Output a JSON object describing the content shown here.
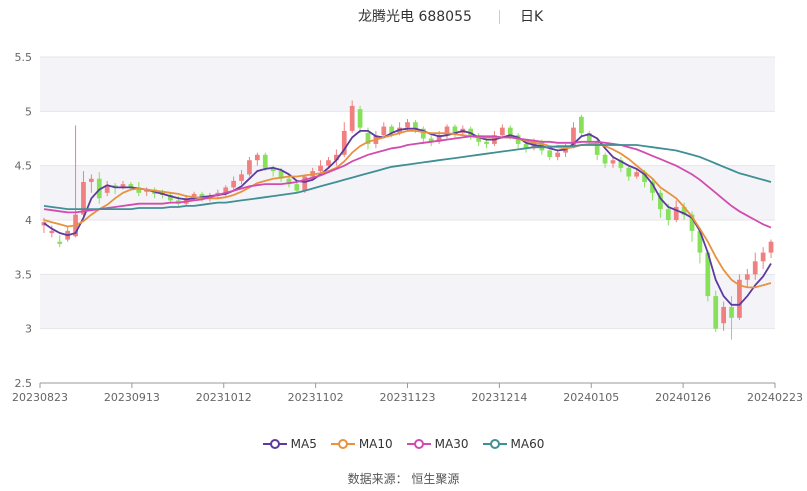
{
  "header": {
    "title": "龙腾光电 688055",
    "period": "日K"
  },
  "source_text": "数据来源： 恒生聚源",
  "colors": {
    "up": "#f08080",
    "down": "#86e05a",
    "ma5": "#5b3b9e",
    "ma10": "#e8913f",
    "ma30": "#d24bb0",
    "ma60": "#3f8f94",
    "grid_band": "#f4f4f8"
  },
  "chart_data": {
    "type": "candlestick",
    "x_ticks": [
      "20230823",
      "20230913",
      "20231012",
      "20231102",
      "20231123",
      "20231214",
      "20240105",
      "20240126",
      "20240223"
    ],
    "ylim": [
      2.5,
      5.5
    ],
    "y_ticks": [
      "5.5",
      "5",
      "4.5",
      "4",
      "3.5",
      "3",
      "2.5"
    ],
    "legend": [
      "MA5",
      "MA10",
      "MA30",
      "MA60"
    ],
    "legend_position": "bottom",
    "candles": [
      [
        3.95,
        3.98,
        3.88,
        4.02
      ],
      [
        3.88,
        3.9,
        3.84,
        3.95
      ],
      [
        3.8,
        3.78,
        3.75,
        3.86
      ],
      [
        3.82,
        3.9,
        3.8,
        3.94
      ],
      [
        3.85,
        4.05,
        3.84,
        4.87
      ],
      [
        4.05,
        4.35,
        4.02,
        4.45
      ],
      [
        4.35,
        4.38,
        4.25,
        4.42
      ],
      [
        4.38,
        4.2,
        4.15,
        4.44
      ],
      [
        4.25,
        4.32,
        4.22,
        4.36
      ],
      [
        4.32,
        4.3,
        4.24,
        4.34
      ],
      [
        4.3,
        4.33,
        4.28,
        4.36
      ],
      [
        4.33,
        4.3,
        4.27,
        4.35
      ],
      [
        4.3,
        4.25,
        4.22,
        4.35
      ],
      [
        4.26,
        4.28,
        4.22,
        4.3
      ],
      [
        4.28,
        4.24,
        4.2,
        4.3
      ],
      [
        4.25,
        4.23,
        4.2,
        4.28
      ],
      [
        4.23,
        4.18,
        4.15,
        4.25
      ],
      [
        4.18,
        4.15,
        4.13,
        4.22
      ],
      [
        4.15,
        4.2,
        4.13,
        4.23
      ],
      [
        4.2,
        4.24,
        4.18,
        4.26
      ],
      [
        4.24,
        4.2,
        4.17,
        4.26
      ],
      [
        4.2,
        4.22,
        4.17,
        4.25
      ],
      [
        4.22,
        4.25,
        4.2,
        4.28
      ],
      [
        4.25,
        4.3,
        4.22,
        4.32
      ],
      [
        4.3,
        4.36,
        4.28,
        4.4
      ],
      [
        4.36,
        4.42,
        4.33,
        4.46
      ],
      [
        4.42,
        4.55,
        4.4,
        4.58
      ],
      [
        4.55,
        4.6,
        4.5,
        4.62
      ],
      [
        4.6,
        4.48,
        4.45,
        4.62
      ],
      [
        4.48,
        4.45,
        4.4,
        4.5
      ],
      [
        4.45,
        4.38,
        4.35,
        4.48
      ],
      [
        4.38,
        4.33,
        4.3,
        4.42
      ],
      [
        4.33,
        4.27,
        4.25,
        4.36
      ],
      [
        4.27,
        4.4,
        4.25,
        4.42
      ],
      [
        4.4,
        4.45,
        4.38,
        4.48
      ],
      [
        4.45,
        4.5,
        4.42,
        4.55
      ],
      [
        4.5,
        4.55,
        4.47,
        4.58
      ],
      [
        4.55,
        4.6,
        4.5,
        4.65
      ],
      [
        4.6,
        4.82,
        4.58,
        4.9
      ],
      [
        4.82,
        5.05,
        4.8,
        5.1
      ],
      [
        5.02,
        4.85,
        4.8,
        5.05
      ],
      [
        4.8,
        4.7,
        4.65,
        4.85
      ],
      [
        4.7,
        4.78,
        4.66,
        4.82
      ],
      [
        4.78,
        4.86,
        4.75,
        4.9
      ],
      [
        4.86,
        4.8,
        4.76,
        4.88
      ],
      [
        4.8,
        4.85,
        4.78,
        4.9
      ],
      [
        4.85,
        4.9,
        4.82,
        4.93
      ],
      [
        4.9,
        4.84,
        4.8,
        4.92
      ],
      [
        4.84,
        4.75,
        4.7,
        4.86
      ],
      [
        4.75,
        4.72,
        4.68,
        4.78
      ],
      [
        4.72,
        4.78,
        4.7,
        4.82
      ],
      [
        4.78,
        4.86,
        4.75,
        4.88
      ],
      [
        4.86,
        4.8,
        4.76,
        4.88
      ],
      [
        4.8,
        4.84,
        4.78,
        4.87
      ],
      [
        4.84,
        4.78,
        4.74,
        4.86
      ],
      [
        4.78,
        4.72,
        4.68,
        4.8
      ],
      [
        4.72,
        4.7,
        4.66,
        4.75
      ],
      [
        4.7,
        4.78,
        4.68,
        4.82
      ],
      [
        4.78,
        4.85,
        4.75,
        4.88
      ],
      [
        4.85,
        4.78,
        4.74,
        4.87
      ],
      [
        4.78,
        4.7,
        4.66,
        4.8
      ],
      [
        4.7,
        4.66,
        4.62,
        4.72
      ],
      [
        4.66,
        4.72,
        4.64,
        4.75
      ],
      [
        4.72,
        4.64,
        4.6,
        4.74
      ],
      [
        4.64,
        4.58,
        4.55,
        4.66
      ],
      [
        4.58,
        4.62,
        4.55,
        4.65
      ],
      [
        4.62,
        4.68,
        4.58,
        4.7
      ],
      [
        4.68,
        4.85,
        4.66,
        4.9
      ],
      [
        4.95,
        4.8,
        4.76,
        4.97
      ],
      [
        4.8,
        4.72,
        4.68,
        4.82
      ],
      [
        4.72,
        4.6,
        4.55,
        4.74
      ],
      [
        4.6,
        4.52,
        4.48,
        4.62
      ],
      [
        4.52,
        4.55,
        4.48,
        4.58
      ],
      [
        4.55,
        4.48,
        4.44,
        4.58
      ],
      [
        4.48,
        4.4,
        4.36,
        4.5
      ],
      [
        4.4,
        4.44,
        4.38,
        4.47
      ],
      [
        4.44,
        4.35,
        4.3,
        4.46
      ],
      [
        4.35,
        4.25,
        4.18,
        4.38
      ],
      [
        4.25,
        4.1,
        4.02,
        4.28
      ],
      [
        4.1,
        4.0,
        3.95,
        4.15
      ],
      [
        4.0,
        4.12,
        3.98,
        4.18
      ],
      [
        4.12,
        4.05,
        4.0,
        4.16
      ],
      [
        4.05,
        3.9,
        3.8,
        4.08
      ],
      [
        3.9,
        3.7,
        3.6,
        3.92
      ],
      [
        3.7,
        3.3,
        3.25,
        3.72
      ],
      [
        3.3,
        3.0,
        2.97,
        3.35
      ],
      [
        3.05,
        3.2,
        2.98,
        3.25
      ],
      [
        3.2,
        3.1,
        2.9,
        3.3
      ],
      [
        3.1,
        3.45,
        3.08,
        3.5
      ],
      [
        3.45,
        3.5,
        3.38,
        3.55
      ],
      [
        3.5,
        3.62,
        3.45,
        3.7
      ],
      [
        3.62,
        3.7,
        3.55,
        3.75
      ],
      [
        3.7,
        3.8,
        3.65,
        3.82
      ]
    ],
    "series": [
      {
        "name": "MA5",
        "values": [
          3.97,
          3.92,
          3.88,
          3.86,
          3.88,
          4.02,
          4.2,
          4.28,
          4.32,
          4.3,
          4.3,
          4.3,
          4.29,
          4.28,
          4.26,
          4.24,
          4.22,
          4.2,
          4.19,
          4.2,
          4.21,
          4.22,
          4.23,
          4.24,
          4.27,
          4.31,
          4.38,
          4.45,
          4.47,
          4.48,
          4.46,
          4.42,
          4.36,
          4.35,
          4.37,
          4.42,
          4.48,
          4.55,
          4.65,
          4.76,
          4.82,
          4.82,
          4.77,
          4.76,
          4.8,
          4.83,
          4.84,
          4.84,
          4.82,
          4.79,
          4.77,
          4.78,
          4.8,
          4.82,
          4.8,
          4.76,
          4.74,
          4.74,
          4.76,
          4.78,
          4.76,
          4.71,
          4.69,
          4.68,
          4.66,
          4.64,
          4.65,
          4.7,
          4.77,
          4.79,
          4.75,
          4.66,
          4.58,
          4.54,
          4.5,
          4.47,
          4.42,
          4.33,
          4.2,
          4.12,
          4.09,
          4.06,
          4.02,
          3.9,
          3.7,
          3.45,
          3.3,
          3.22,
          3.22,
          3.3,
          3.4,
          3.48,
          3.6
        ]
      },
      {
        "name": "MA10",
        "values": [
          4.0,
          3.98,
          3.96,
          3.94,
          3.95,
          3.99,
          4.05,
          4.1,
          4.14,
          4.2,
          4.25,
          4.28,
          4.29,
          4.28,
          4.27,
          4.26,
          4.25,
          4.24,
          4.22,
          4.21,
          4.2,
          4.2,
          4.2,
          4.21,
          4.23,
          4.26,
          4.3,
          4.34,
          4.36,
          4.38,
          4.39,
          4.4,
          4.4,
          4.41,
          4.42,
          4.43,
          4.45,
          4.48,
          4.54,
          4.62,
          4.68,
          4.72,
          4.74,
          4.76,
          4.78,
          4.8,
          4.82,
          4.82,
          4.81,
          4.8,
          4.8,
          4.8,
          4.79,
          4.78,
          4.77,
          4.76,
          4.76,
          4.76,
          4.76,
          4.76,
          4.75,
          4.73,
          4.71,
          4.7,
          4.68,
          4.67,
          4.66,
          4.67,
          4.69,
          4.7,
          4.7,
          4.68,
          4.65,
          4.61,
          4.56,
          4.5,
          4.44,
          4.38,
          4.3,
          4.25,
          4.2,
          4.12,
          4.03,
          3.92,
          3.8,
          3.66,
          3.54,
          3.45,
          3.4,
          3.38,
          3.38,
          3.4,
          3.42
        ]
      },
      {
        "name": "MA30",
        "values": [
          4.1,
          4.09,
          4.08,
          4.07,
          4.07,
          4.08,
          4.09,
          4.1,
          4.11,
          4.12,
          4.13,
          4.14,
          4.15,
          4.15,
          4.15,
          4.15,
          4.16,
          4.16,
          4.17,
          4.18,
          4.19,
          4.21,
          4.23,
          4.25,
          4.27,
          4.29,
          4.31,
          4.32,
          4.33,
          4.33,
          4.33,
          4.34,
          4.35,
          4.37,
          4.39,
          4.41,
          4.44,
          4.47,
          4.5,
          4.54,
          4.57,
          4.6,
          4.62,
          4.64,
          4.66,
          4.67,
          4.69,
          4.7,
          4.71,
          4.72,
          4.73,
          4.74,
          4.75,
          4.76,
          4.77,
          4.77,
          4.77,
          4.77,
          4.76,
          4.76,
          4.75,
          4.74,
          4.73,
          4.72,
          4.72,
          4.71,
          4.71,
          4.71,
          4.72,
          4.72,
          4.72,
          4.71,
          4.7,
          4.69,
          4.67,
          4.65,
          4.62,
          4.59,
          4.56,
          4.53,
          4.5,
          4.46,
          4.42,
          4.37,
          4.31,
          4.25,
          4.19,
          4.13,
          4.08,
          4.04,
          4.0,
          3.96,
          3.93
        ]
      },
      {
        "name": "MA60",
        "values": [
          4.13,
          4.12,
          4.11,
          4.1,
          4.1,
          4.1,
          4.1,
          4.1,
          4.1,
          4.1,
          4.1,
          4.1,
          4.11,
          4.11,
          4.11,
          4.11,
          4.12,
          4.12,
          4.13,
          4.13,
          4.14,
          4.15,
          4.16,
          4.16,
          4.17,
          4.18,
          4.19,
          4.2,
          4.21,
          4.22,
          4.23,
          4.24,
          4.25,
          4.27,
          4.29,
          4.31,
          4.33,
          4.35,
          4.37,
          4.39,
          4.41,
          4.43,
          4.45,
          4.47,
          4.49,
          4.5,
          4.51,
          4.52,
          4.53,
          4.54,
          4.55,
          4.56,
          4.57,
          4.58,
          4.59,
          4.6,
          4.61,
          4.62,
          4.63,
          4.64,
          4.65,
          4.66,
          4.67,
          4.67,
          4.67,
          4.68,
          4.68,
          4.68,
          4.69,
          4.69,
          4.69,
          4.69,
          4.69,
          4.69,
          4.69,
          4.69,
          4.68,
          4.67,
          4.66,
          4.65,
          4.64,
          4.62,
          4.6,
          4.58,
          4.55,
          4.52,
          4.49,
          4.46,
          4.43,
          4.41,
          4.39,
          4.37,
          4.35
        ]
      }
    ]
  }
}
